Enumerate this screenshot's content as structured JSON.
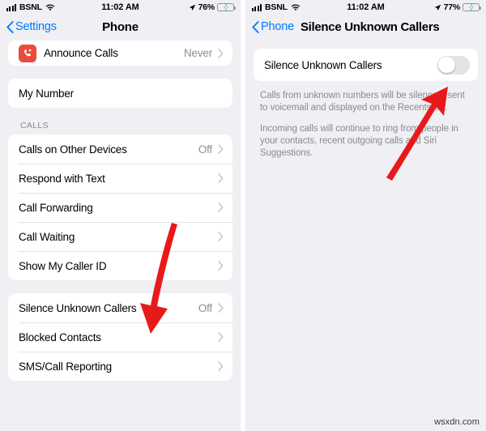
{
  "left": {
    "status_bar": {
      "carrier": "BSNL",
      "time": "11:02 AM",
      "battery_pct": "76%",
      "signal_icon": "signal-bars-icon",
      "wifi_icon": "wifi-icon",
      "location_icon": "location-arrow-icon",
      "battery_icon": "battery-charging-icon"
    },
    "nav": {
      "back_label": "Settings",
      "title": "Phone",
      "back_icon": "chevron-left-icon"
    },
    "group_announce": {
      "rows": [
        {
          "label": "Announce Calls",
          "value": "Never",
          "icon": "phone-announce-icon",
          "chevron": "chevron-right-icon"
        }
      ]
    },
    "group_mynumber": {
      "rows": [
        {
          "label": "My Number",
          "value": "",
          "chevron": ""
        }
      ]
    },
    "calls_header": "CALLS",
    "group_calls": {
      "rows": [
        {
          "label": "Calls on Other Devices",
          "value": "Off",
          "chevron": "chevron-right-icon"
        },
        {
          "label": "Respond with Text",
          "value": "",
          "chevron": "chevron-right-icon"
        },
        {
          "label": "Call Forwarding",
          "value": "",
          "chevron": "chevron-right-icon"
        },
        {
          "label": "Call Waiting",
          "value": "",
          "chevron": "chevron-right-icon"
        },
        {
          "label": "Show My Caller ID",
          "value": "",
          "chevron": "chevron-right-icon"
        }
      ]
    },
    "group_silence": {
      "rows": [
        {
          "label": "Silence Unknown Callers",
          "value": "Off",
          "chevron": "chevron-right-icon"
        },
        {
          "label": "Blocked Contacts",
          "value": "",
          "chevron": "chevron-right-icon"
        },
        {
          "label": "SMS/Call Reporting",
          "value": "",
          "chevron": "chevron-right-icon"
        }
      ]
    }
  },
  "right": {
    "status_bar": {
      "carrier": "BSNL",
      "time": "11:02 AM",
      "battery_pct": "77%",
      "signal_icon": "signal-bars-icon",
      "wifi_icon": "wifi-icon",
      "location_icon": "location-arrow-icon",
      "battery_icon": "battery-charging-icon"
    },
    "nav": {
      "back_label": "Phone",
      "title": "Silence Unknown Callers",
      "back_icon": "chevron-left-icon"
    },
    "toggle": {
      "label": "Silence Unknown Callers",
      "state": "off"
    },
    "footer": {
      "paragraph_1": "Calls from unknown numbers will be silenced, sent to voicemail and displayed on the Recents list.",
      "paragraph_2": "Incoming calls will continue to ring from people in your contacts, recent outgoing calls and Siri Suggestions."
    }
  },
  "annotations": {
    "arrow_color": "#e8191a",
    "arrow_left_name": "arrow-pointing-to-silence-unknown-callers",
    "arrow_right_name": "arrow-pointing-to-toggle"
  },
  "watermark": "wsxdn.com",
  "colors": {
    "accent_blue": "#007aff",
    "panel_bg": "#efeff4",
    "card_bg": "#ffffff",
    "secondary_text": "#8e8e93",
    "icon_red": "#eb4b3c",
    "battery_green": "#34c759",
    "arrow_red": "#e8191a"
  }
}
